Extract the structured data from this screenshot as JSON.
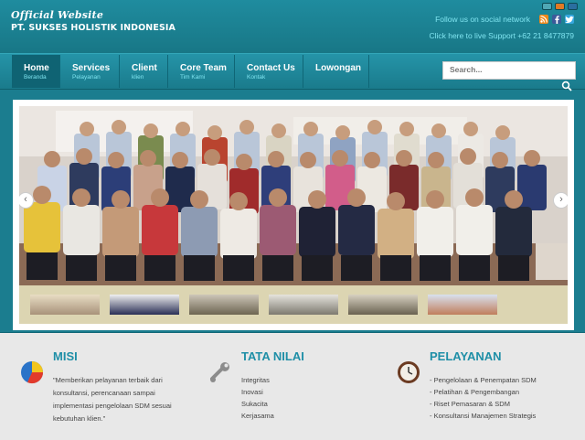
{
  "header": {
    "official": "Official Website",
    "company": "PT. SUKSES HOLISTIK INDONESIA",
    "social_text": "Follow us on social network",
    "social_icons": [
      "rss-icon",
      "facebook-icon",
      "twitter-icon"
    ],
    "support": "Click here to live Support +62 21 8477879"
  },
  "nav": {
    "items": [
      {
        "label": "Home",
        "sub": "Beranda",
        "active": true
      },
      {
        "label": "Services",
        "sub": "Pelayanan"
      },
      {
        "label": "Client",
        "sub": "klien"
      },
      {
        "label": "Core Team",
        "sub": "Tim Kami"
      },
      {
        "label": "Contact Us",
        "sub": "Kontak"
      },
      {
        "label": "Lowongan",
        "sub": ""
      }
    ],
    "search_placeholder": "Search..."
  },
  "sections": {
    "misi": {
      "title": "MISI",
      "text": "\"Memberikan pelayanan terbaik dari konsultansi, perencanaan sampai implementasi pengelolaan SDM sesuai kebutuhan klien.\""
    },
    "tata_nilai": {
      "title": "TATA NILAI",
      "items": [
        "Integritas",
        "Inovasi",
        "Sukacita",
        "Kerjasama"
      ]
    },
    "pelayanan": {
      "title": "PELAYANAN",
      "items": [
        "- Pengelolaan & Penempatan SDM",
        "- Pelatihan & Pengembangan",
        "- Riset Pemasaran & SDM",
        "- Konsultansi Manajemen Strategis"
      ]
    }
  },
  "colors": {
    "teal_bg": "#1b7d8f",
    "accent_text": "#1f8fa7",
    "link_cyan": "#7fe4f0"
  }
}
